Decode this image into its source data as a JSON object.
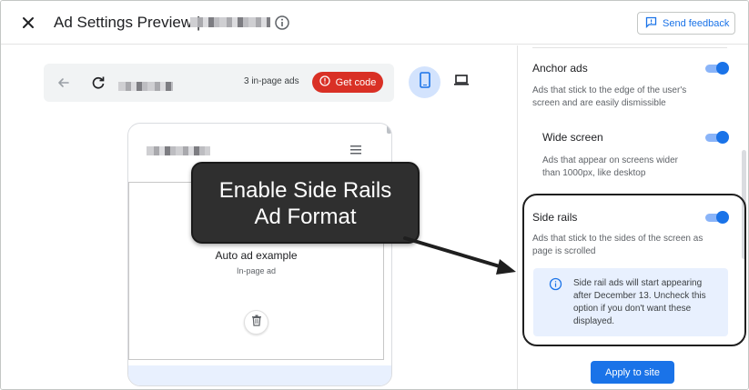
{
  "header": {
    "title": "Ad Settings Preview |",
    "feedback_label": "Send feedback"
  },
  "toolbar": {
    "ad_count": "3 in-page ads",
    "get_code_label": "Get code"
  },
  "preview": {
    "ad_title": "Auto ad example",
    "ad_subtitle": "In-page ad"
  },
  "callout": {
    "line1": "Enable Side Rails",
    "line2": "Ad Format"
  },
  "settings": {
    "anchor": {
      "title": "Anchor ads",
      "desc": "Ads that stick to the edge of the user's screen and are easily dismissible",
      "enabled": true
    },
    "wide": {
      "title": "Wide screen",
      "desc": "Ads that appear on screens wider than 1000px, like desktop",
      "enabled": true
    },
    "side_rails": {
      "title": "Side rails",
      "desc": "Ads that stick to the sides of the screen as page is scrolled",
      "enabled": true,
      "notice": "Side rail ads will start appearing after December 13. Uncheck this option if you don't want these displayed."
    },
    "apply_label": "Apply to site"
  },
  "colors": {
    "accent": "#1a73e8",
    "danger": "#d93025",
    "notice_bg": "#e8f0fe"
  },
  "icons": [
    "close-icon",
    "info-icon",
    "feedback-icon",
    "back-arrow-icon",
    "reload-icon",
    "error-circle-icon",
    "phone-icon",
    "laptop-icon",
    "menu-icon",
    "trash-icon",
    "info-icon"
  ]
}
